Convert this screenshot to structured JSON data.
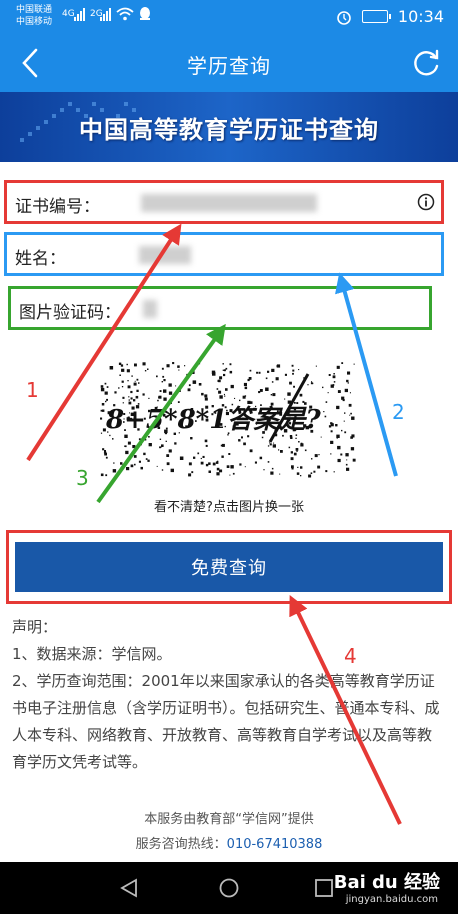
{
  "status": {
    "carrier1": "中国联通",
    "carrier2": "中国移动",
    "net1": "4G",
    "net2": "2G",
    "time": "10:34"
  },
  "nav": {
    "title": "学历查询"
  },
  "banner": {
    "title": "中国高等教育学历证书查询"
  },
  "form": {
    "cert_label": "证书编号：",
    "name_label": "姓名：",
    "captcha_label": "图片验证码："
  },
  "captcha": {
    "text": "8+5*8*1答案是?",
    "hint": "看不清楚?点击图片换一张"
  },
  "button": {
    "label": "免费查询"
  },
  "declaration": {
    "heading": "声明：",
    "line1": "1、数据来源：学信网。",
    "line2": "2、学历查询范围：2001年以来国家承认的各类高等教育学历证书电子注册信息（含学历证明书）。包括研究生、普通本专科、成人本专科、网络教育、开放教育、高等教育自学考试以及高等教育学历文凭考试等。"
  },
  "footer": {
    "line1": "本服务由教育部“学信网”提供",
    "hotline_label": "服务咨询热线：",
    "hotline": "010-67410388"
  },
  "watermark": {
    "brand": "Bai du 经验",
    "url": "jingyan.baidu.com"
  },
  "annotations": {
    "n1": "1",
    "n2": "2",
    "n3": "3",
    "n4": "4"
  },
  "colors": {
    "primary": "#1c8ae6",
    "button": "#1958a8",
    "red": "#e53935",
    "blue": "#2b9af3",
    "green": "#37a52f"
  }
}
